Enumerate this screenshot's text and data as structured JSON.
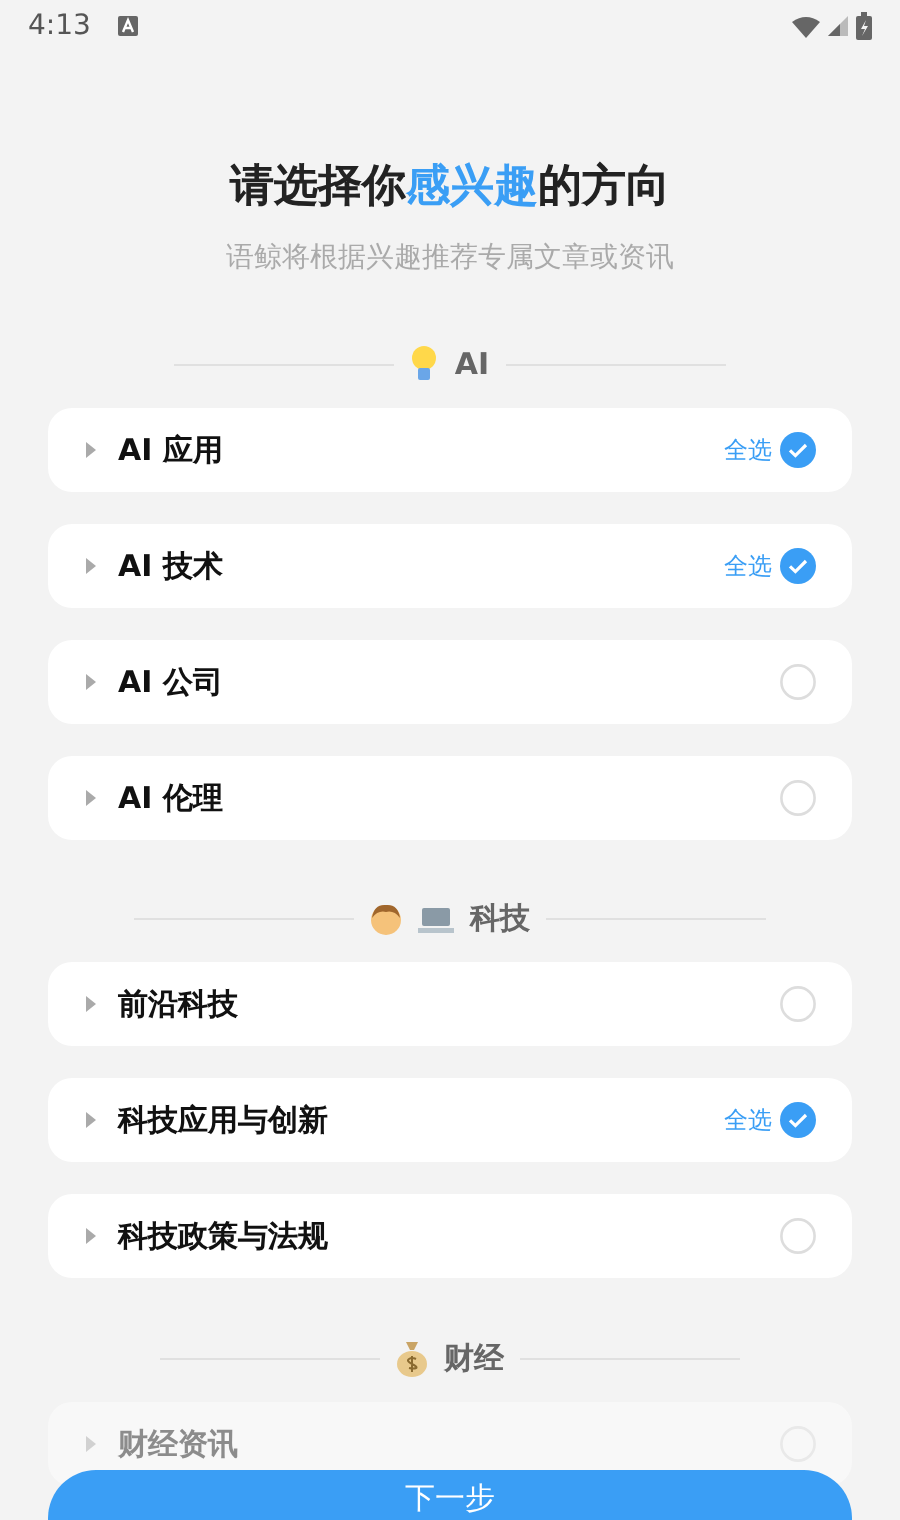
{
  "status_bar": {
    "time": "4:13"
  },
  "title": {
    "parts": [
      {
        "text": "请选择你",
        "highlight": false
      },
      {
        "text": "感兴趣",
        "highlight": true
      },
      {
        "text": "的方向",
        "highlight": false
      }
    ]
  },
  "subtitle": "语鲸将根据兴趣推荐专属文章或资讯",
  "sections": [
    {
      "kind": "bulb",
      "label": "AI",
      "items": [
        {
          "label": "AI 应用",
          "checked": true,
          "select_all": "全选",
          "faded": false
        },
        {
          "label": "AI 技术",
          "checked": true,
          "select_all": "全选",
          "faded": false
        },
        {
          "label": "AI 公司",
          "checked": false,
          "faded": false
        },
        {
          "label": "AI 伦理",
          "checked": false,
          "faded": false
        }
      ]
    },
    {
      "kind": "tech",
      "label": "科技",
      "items": [
        {
          "label": "前沿科技",
          "checked": false,
          "faded": false
        },
        {
          "label": "科技应用与创新",
          "checked": true,
          "select_all": "全选",
          "faded": false
        },
        {
          "label": "科技政策与法规",
          "checked": false,
          "faded": false
        }
      ]
    },
    {
      "kind": "money",
      "label": "财经",
      "items": [
        {
          "label": "财经资讯",
          "checked": false,
          "faded": true
        }
      ]
    }
  ],
  "next_button": "下一步"
}
